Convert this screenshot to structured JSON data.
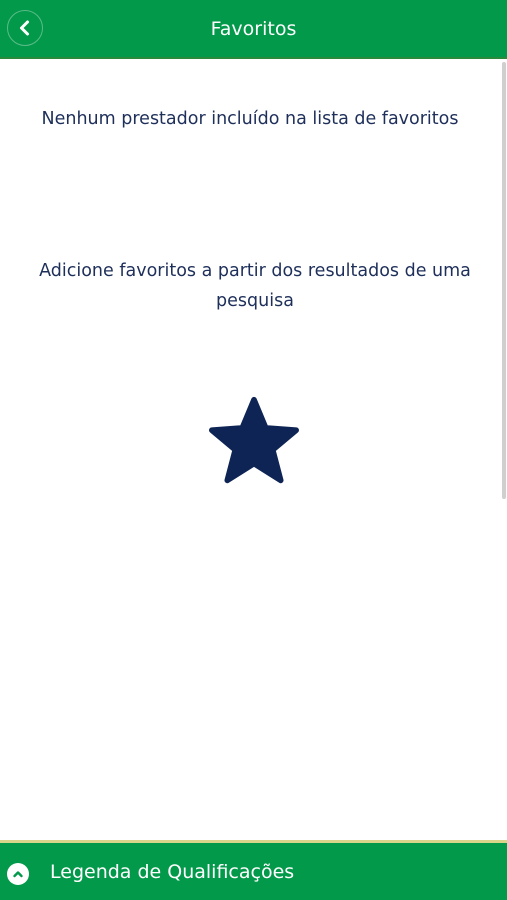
{
  "header": {
    "title": "Favoritos",
    "back_icon": "chevron-left-icon",
    "background_color": "#03994a"
  },
  "content": {
    "empty_message": "Nenhum prestador incluído na lista de favoritos",
    "hint_message": "Adicione favoritos a partir dos resultados de uma pesquisa",
    "illustration_icon": "star-icon",
    "text_color": "#1e2f5a"
  },
  "footer": {
    "label": "Legenda de Qualificações",
    "toggle_icon": "chevron-up-icon",
    "background_color": "#03994a"
  }
}
